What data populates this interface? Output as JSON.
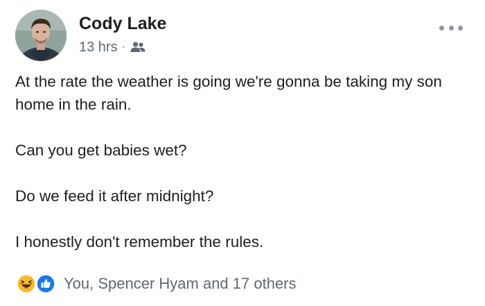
{
  "post": {
    "author": {
      "name": "Cody Lake",
      "avatar_icon": "profile-photo"
    },
    "meta": {
      "time": "13 hrs",
      "separator": "·",
      "audience_icon": "friends-icon"
    },
    "menu_icon": "more-options-icon",
    "paragraphs": [
      "At the rate the weather is going we're gonna be taking my son home in the rain.",
      "Can you get babies wet?",
      "Do we feed it after midnight?",
      "I honestly don't remember the rules."
    ],
    "reactions": {
      "icons": [
        "haha-icon",
        "like-icon"
      ],
      "summary": "You, Spencer Hyam and 17 others"
    }
  },
  "colors": {
    "text": "#1c1e21",
    "secondary_text": "#606770",
    "like_blue": "#1877f2",
    "haha_yellow": "#f7b928"
  }
}
